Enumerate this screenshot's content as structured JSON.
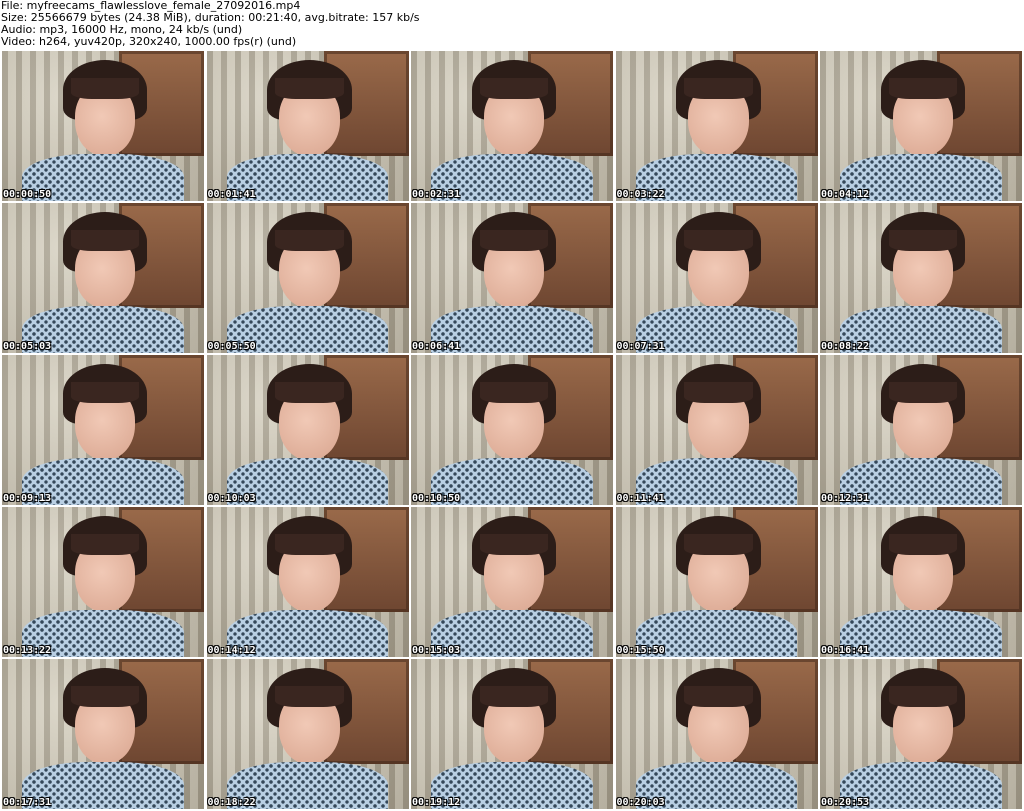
{
  "header": {
    "file_line": "File: myfreecams_flawlesslove_female_27092016.mp4",
    "size_line": "Size: 25566679 bytes (24.38 MiB), duration: 00:21:40, avg.bitrate: 157 kb/s",
    "audio_line": "Audio: mp3, 16000 Hz, mono, 24 kb/s (und)",
    "video_line": "Video: h264, yuv420p, 320x240, 1000.00 fps(r) (und)"
  },
  "frames": [
    {
      "timestamp": "00:00:50"
    },
    {
      "timestamp": "00:01:41"
    },
    {
      "timestamp": "00:02:31"
    },
    {
      "timestamp": "00:03:22"
    },
    {
      "timestamp": "00:04:12"
    },
    {
      "timestamp": "00:05:03"
    },
    {
      "timestamp": "00:05:50"
    },
    {
      "timestamp": "00:06:41"
    },
    {
      "timestamp": "00:07:31"
    },
    {
      "timestamp": "00:08:22"
    },
    {
      "timestamp": "00:09:13"
    },
    {
      "timestamp": "00:10:03"
    },
    {
      "timestamp": "00:10:50"
    },
    {
      "timestamp": "00:11:41"
    },
    {
      "timestamp": "00:12:31"
    },
    {
      "timestamp": "00:13:22"
    },
    {
      "timestamp": "00:14:12"
    },
    {
      "timestamp": "00:15:03"
    },
    {
      "timestamp": "00:15:50"
    },
    {
      "timestamp": "00:16:41"
    },
    {
      "timestamp": "00:17:31"
    },
    {
      "timestamp": "00:18:22"
    },
    {
      "timestamp": "00:19:12"
    },
    {
      "timestamp": "00:20:03"
    },
    {
      "timestamp": "00:20:53"
    }
  ]
}
